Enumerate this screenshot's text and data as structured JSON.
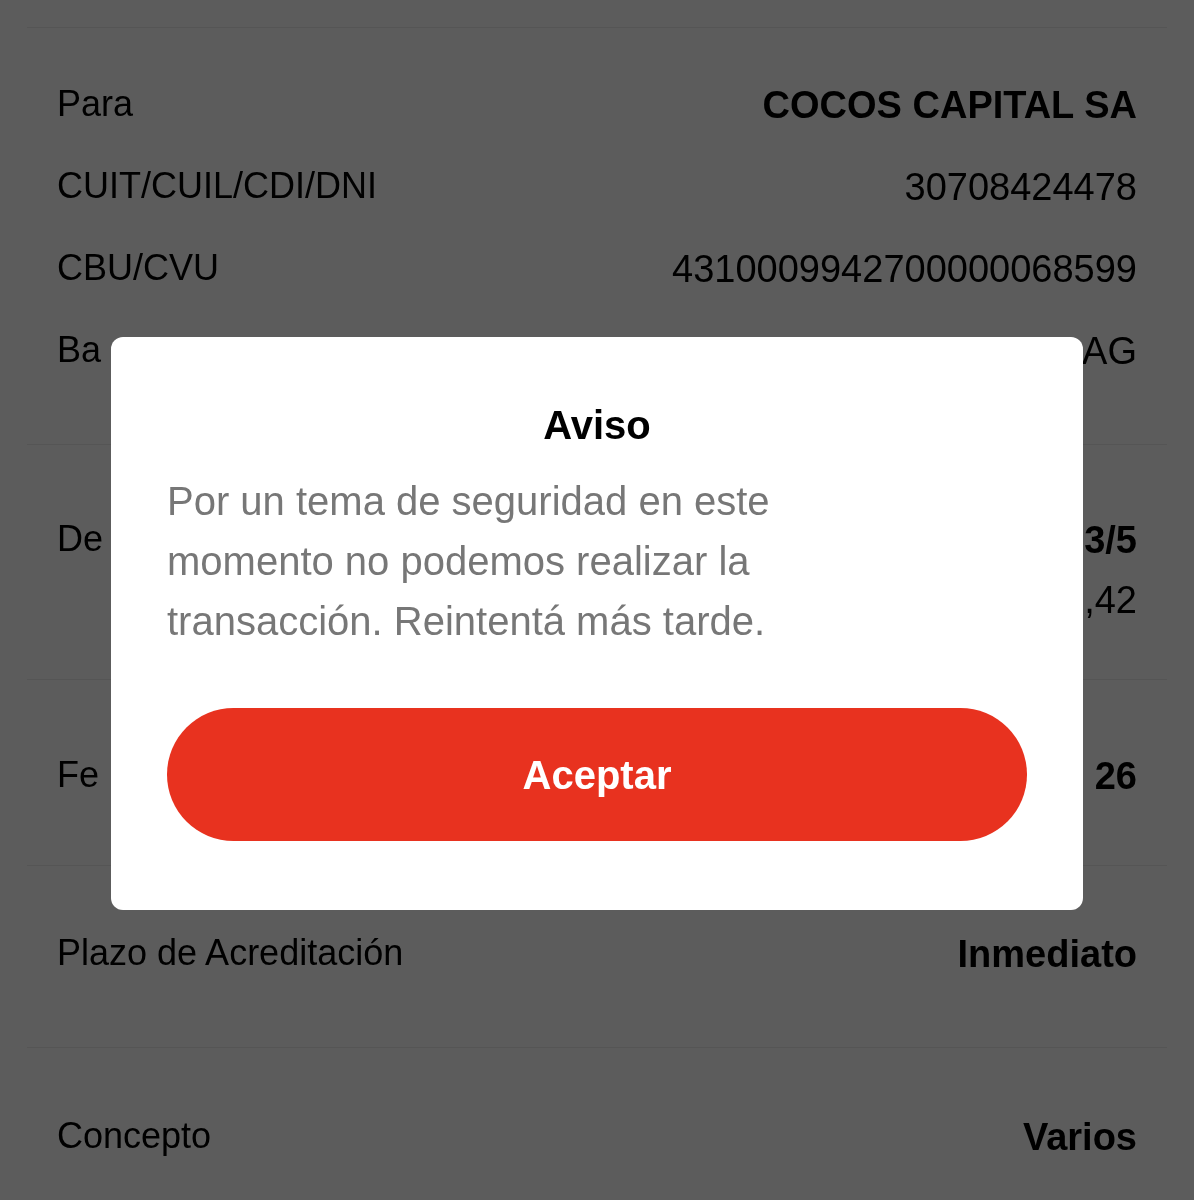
{
  "sections": [
    {
      "rows": [
        {
          "label": "Para",
          "values": [
            {
              "text": "COCOS CAPITAL SA",
              "bold": true
            }
          ]
        },
        {
          "label": "CUIT/CUIL/CDI/DNI",
          "values": [
            {
              "text": "30708424478",
              "bold": false
            }
          ]
        },
        {
          "label": "CBU/CVU",
          "values": [
            {
              "text": "4310009942700000068599",
              "bold": false
            }
          ]
        },
        {
          "label": "Ba",
          "values": [
            {
              "text": "AG",
              "bold": false
            }
          ]
        }
      ]
    },
    {
      "rows": [
        {
          "label": "De",
          "values": [
            {
              "text": "3/5",
              "bold": true
            },
            {
              "text": ",42",
              "bold": false
            }
          ]
        }
      ]
    },
    {
      "rows": [
        {
          "label": "Fe",
          "values": [
            {
              "text": "26",
              "bold": true
            }
          ]
        }
      ]
    },
    {
      "rows": [
        {
          "label": "Plazo de Acreditación",
          "values": [
            {
              "text": "Inmediato",
              "bold": true
            }
          ]
        }
      ]
    },
    {
      "rows": [
        {
          "label": "Concepto",
          "values": [
            {
              "text": "Varios",
              "bold": true
            }
          ]
        }
      ]
    }
  ],
  "dialog": {
    "title": "Aviso",
    "message": "Por un tema de seguridad en este momento no podemos realizar la transacción. Reintentá más tarde.",
    "button": "Aceptar"
  }
}
